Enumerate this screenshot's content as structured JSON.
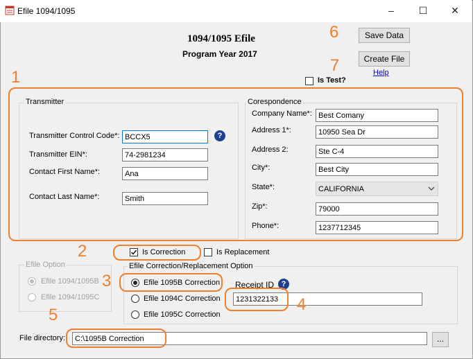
{
  "window": {
    "title": "Efile 1094/1095",
    "minimize": "–",
    "maximize": "☐",
    "close": "✕"
  },
  "header": {
    "title": "1094/1095 Efile",
    "subtitle": "Program Year 2017",
    "save_label": "Save Data",
    "create_label": "Create File",
    "help_link": "Help ",
    "is_test_label": "Is Test?",
    "is_test_checked": false
  },
  "transmitter": {
    "group_label": "Transmitter",
    "fields": [
      {
        "label": "Transmitter Control Code*:",
        "value": "BCCX5"
      },
      {
        "label": "Transmitter EIN*:",
        "value": "74-2981234"
      },
      {
        "label": "Contact First Name*:",
        "value": "Ana"
      },
      {
        "label": "Contact Last Name*:",
        "value": "Smith"
      }
    ],
    "help_icon": "?"
  },
  "correspondence": {
    "group_label": "Corespondence",
    "fields": [
      {
        "label": "Company Name*:",
        "value": "Best Comany"
      },
      {
        "label": "Address 1*:",
        "value": "10950 Sea Dr"
      },
      {
        "label": "Address 2:",
        "value": "Ste C-4"
      },
      {
        "label": "City*:",
        "value": "Best City"
      },
      {
        "label": "State*:",
        "value": "CALIFORNIA"
      },
      {
        "label": "Zip*:",
        "value": "79000"
      },
      {
        "label": "Phone*:",
        "value": "1237712345"
      }
    ]
  },
  "correction": {
    "is_correction_label": "Is Correction",
    "is_correction_checked": true,
    "is_replacement_label": "Is Replacement",
    "is_replacement_checked": false
  },
  "efile_option": {
    "group_label": "Efile Option",
    "options": [
      "Efile 1094/1095B",
      "Efile 1094/1095C"
    ],
    "selected": "Efile 1094/1095B"
  },
  "correction_option": {
    "group_label": "Efile Correction/Replacement Option",
    "options": [
      "Efile 1095B Correction",
      "Efile 1094C Correction",
      "Efile 1095C Correction"
    ],
    "selected": "Efile 1095B Correction",
    "receipt_label": "Receipt ID",
    "receipt_value": "1231322133",
    "help_icon": "?"
  },
  "file_directory": {
    "label": "File directory:",
    "value": "C:\\1095B Correction",
    "browse_label": "..."
  },
  "annotations": [
    "1",
    "2",
    "3",
    "4",
    "5",
    "6",
    "7"
  ],
  "colors": {
    "annotation": "#ee7f2d",
    "help_icon": "#1f3f8f",
    "link": "#0000ee"
  }
}
